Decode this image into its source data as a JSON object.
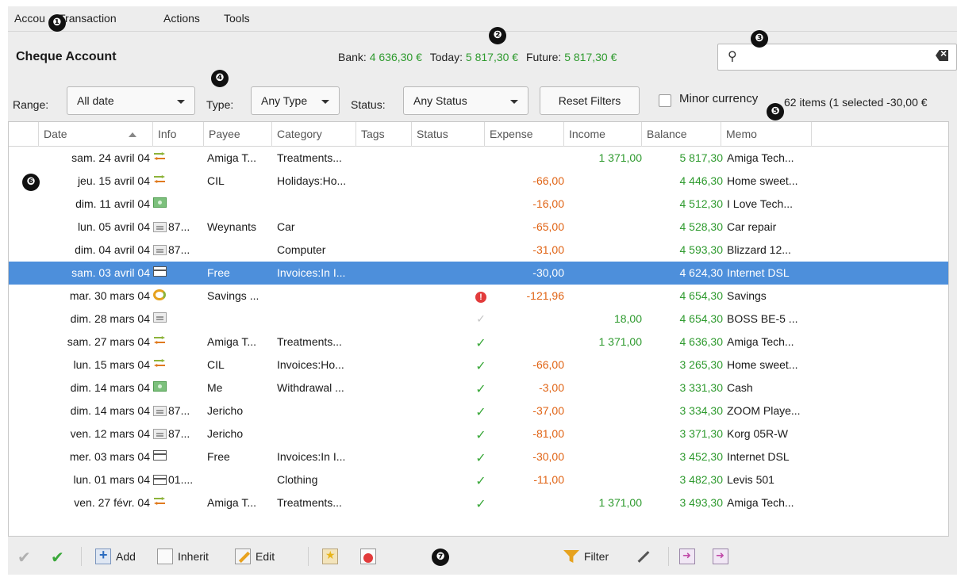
{
  "menu": [
    "Accou",
    "Transaction",
    "Actions",
    "Tools"
  ],
  "account": {
    "title": "Cheque Account",
    "bank_label": "Bank:",
    "bank_value": "4 636,30 €",
    "today_label": "Today:",
    "today_value": "5 817,30 €",
    "future_label": "Future:",
    "future_value": "5 817,30 €"
  },
  "search": {
    "placeholder": "",
    "value": ""
  },
  "filters": {
    "range_label": "Range:",
    "range_value": "All date",
    "type_label": "Type:",
    "type_value": "Any Type",
    "status_label": "Status:",
    "status_value": "Any Status",
    "reset_label": "Reset Filters",
    "minor_label": "Minor currency",
    "items_text": "62 items (1 selected -30,00 €"
  },
  "columns": [
    "Date",
    "Info",
    "Payee",
    "Category",
    "Tags",
    "Status",
    "Expense",
    "Income",
    "Balance",
    "Memo"
  ],
  "rows": [
    {
      "date": "sam. 24 avril 04",
      "info_icon": "transfer-icon",
      "info": "",
      "payee": "Amiga T...",
      "category": "Treatments...",
      "status": "",
      "expense": "",
      "income": "1 371,00",
      "balance": "5 817,30",
      "memo": "Amiga Tech..."
    },
    {
      "date": "jeu. 15 avril 04",
      "info_icon": "transfer-icon",
      "info": "",
      "payee": "CIL",
      "category": "Holidays:Ho...",
      "status": "",
      "expense": "-66,00",
      "income": "",
      "balance": "4 446,30",
      "memo": "Home sweet..."
    },
    {
      "date": "dim. 11 avril 04",
      "info_icon": "cash-icon",
      "info": "",
      "payee": "",
      "category": "",
      "status": "",
      "expense": "-16,00",
      "income": "",
      "balance": "4 512,30",
      "memo": "I Love Tech..."
    },
    {
      "date": "lun. 05 avril 04",
      "info_icon": "cheque-icon",
      "info": "87...",
      "payee": "Weynants",
      "category": "Car",
      "status": "",
      "expense": "-65,00",
      "income": "",
      "balance": "4 528,30",
      "memo": "Car repair"
    },
    {
      "date": "dim. 04 avril 04",
      "info_icon": "cheque-icon",
      "info": "87...",
      "payee": "",
      "category": "Computer",
      "status": "",
      "expense": "-31,00",
      "income": "",
      "balance": "4 593,30",
      "memo": "Blizzard 12..."
    },
    {
      "date": "sam. 03 avril 04",
      "info_icon": "card-icon",
      "info": "",
      "payee": "Free",
      "category": "Invoices:In I...",
      "status": "",
      "expense": "-30,00",
      "income": "",
      "balance": "4 624,30",
      "memo": "Internet DSL",
      "selected": true
    },
    {
      "date": "mar. 30 mars 04",
      "info_icon": "savings-icon",
      "info": "",
      "payee": "Savings ...",
      "category": "",
      "status": "warning",
      "expense": "-121,96",
      "income": "",
      "balance": "4 654,30",
      "memo": "Savings"
    },
    {
      "date": "dim. 28 mars 04",
      "info_icon": "cheque-icon",
      "info": "",
      "payee": "",
      "category": "",
      "status": "cleared",
      "expense": "",
      "income": "18,00",
      "balance": "4 654,30",
      "memo": "BOSS BE-5 ..."
    },
    {
      "date": "sam. 27 mars 04",
      "info_icon": "transfer-icon",
      "info": "",
      "payee": "Amiga T...",
      "category": "Treatments...",
      "status": "reconciled",
      "expense": "",
      "income": "1 371,00",
      "balance": "4 636,30",
      "memo": "Amiga Tech..."
    },
    {
      "date": "lun. 15 mars 04",
      "info_icon": "transfer-icon",
      "info": "",
      "payee": "CIL",
      "category": "Invoices:Ho...",
      "status": "reconciled",
      "expense": "-66,00",
      "income": "",
      "balance": "3 265,30",
      "memo": "Home sweet..."
    },
    {
      "date": "dim. 14 mars 04",
      "info_icon": "cash-icon",
      "info": "",
      "payee": "Me",
      "category": "Withdrawal ...",
      "status": "reconciled",
      "expense": "-3,00",
      "income": "",
      "balance": "3 331,30",
      "memo": "Cash"
    },
    {
      "date": "dim. 14 mars 04",
      "info_icon": "cheque-icon",
      "info": "87...",
      "payee": "Jericho",
      "category": "",
      "status": "reconciled",
      "expense": "-37,00",
      "income": "",
      "balance": "3 334,30",
      "memo": "ZOOM Playe..."
    },
    {
      "date": "ven. 12 mars 04",
      "info_icon": "cheque-icon",
      "info": "87...",
      "payee": "Jericho",
      "category": "",
      "status": "reconciled",
      "expense": "-81,00",
      "income": "",
      "balance": "3 371,30",
      "memo": "Korg 05R-W"
    },
    {
      "date": "mer. 03 mars 04",
      "info_icon": "card-icon",
      "info": "",
      "payee": "Free",
      "category": "Invoices:In I...",
      "status": "reconciled",
      "expense": "-30,00",
      "income": "",
      "balance": "3 452,30",
      "memo": "Internet DSL"
    },
    {
      "date": "lun. 01 mars 04",
      "info_icon": "card-icon",
      "info": "01....",
      "payee": "",
      "category": "Clothing",
      "status": "reconciled",
      "expense": "-11,00",
      "income": "",
      "balance": "3 482,30",
      "memo": "Levis 501"
    },
    {
      "date": "ven. 27 févr. 04",
      "info_icon": "transfer-icon",
      "info": "",
      "payee": "Amiga T...",
      "category": "Treatments...",
      "status": "reconciled",
      "expense": "",
      "income": "1 371,00",
      "balance": "3 493,30",
      "memo": "Amiga Tech..."
    }
  ],
  "toolbar": {
    "add_label": "Add",
    "inherit_label": "Inherit",
    "edit_label": "Edit",
    "filter_label": "Filter"
  },
  "callouts": [
    "❶",
    "❷",
    "❸",
    "❹",
    "❺",
    "❻",
    "❼"
  ],
  "colors": {
    "positive": "#2e9a2e",
    "negative": "#e06314",
    "selection": "#4d8fdb"
  }
}
